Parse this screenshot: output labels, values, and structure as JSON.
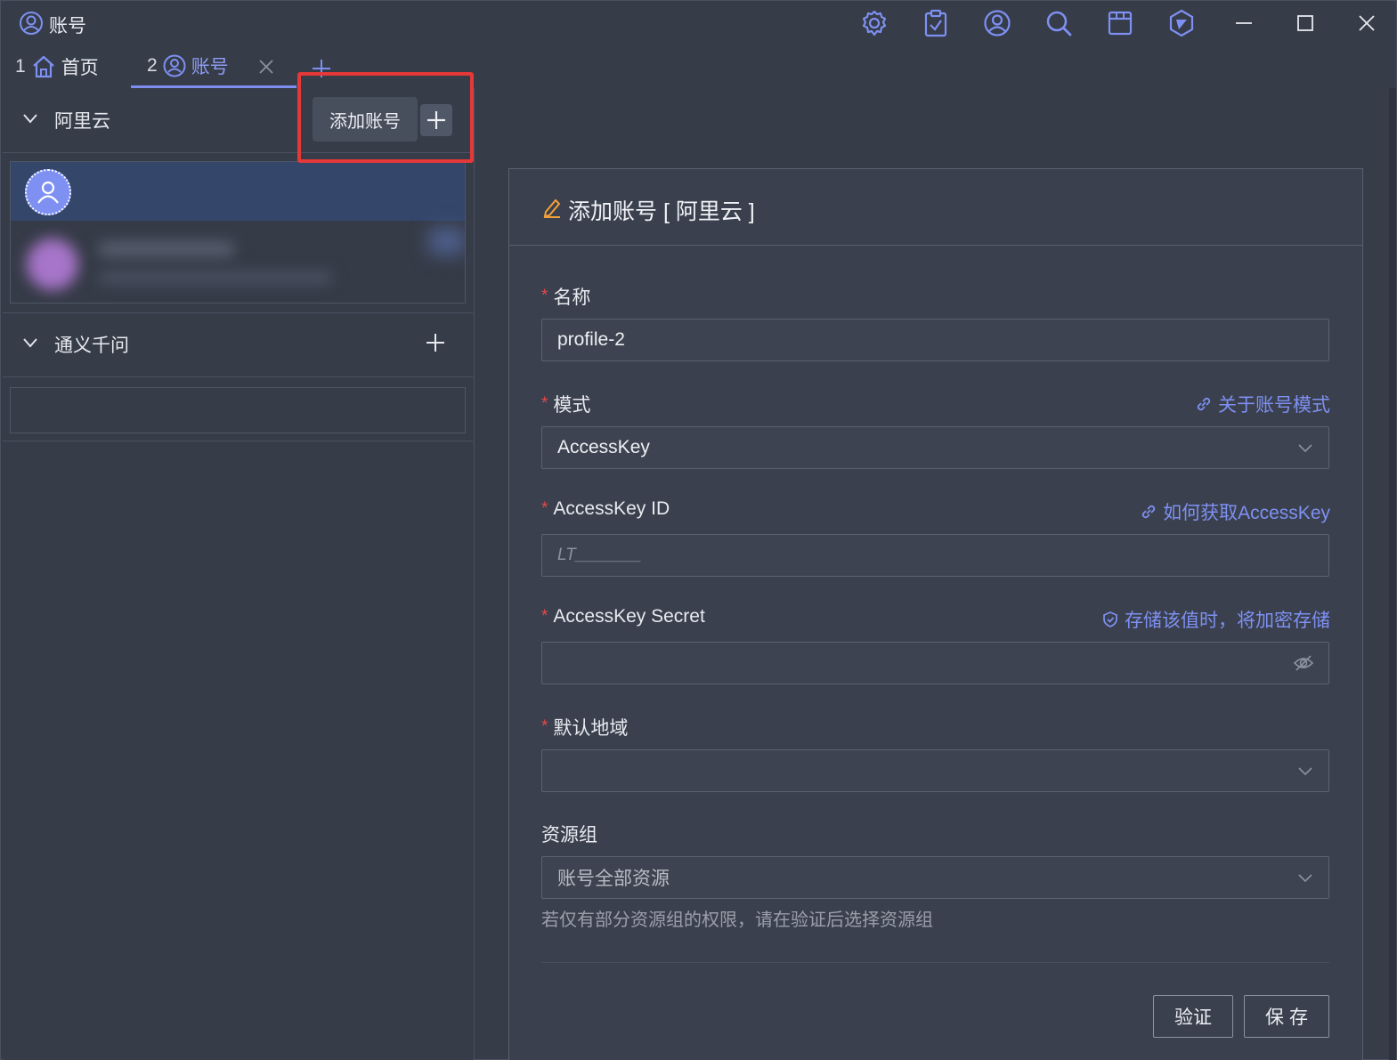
{
  "window": {
    "title": "账号",
    "toolbar_icons": [
      "gear-icon",
      "clipboard-check-icon",
      "user-circle-icon",
      "search-icon",
      "window-icon",
      "logo-icon"
    ],
    "controls": [
      "minimize-icon",
      "maximize-icon",
      "close-icon"
    ]
  },
  "tabs": [
    {
      "num": "1",
      "label": "首页",
      "icon": "home-icon"
    },
    {
      "num": "2",
      "label": "账号",
      "icon": "user-circle-icon",
      "active": true
    }
  ],
  "sidebar": {
    "groups": [
      {
        "name": "阿里云"
      },
      {
        "name": "通义千问"
      }
    ],
    "popup": {
      "label": "添加账号"
    }
  },
  "form": {
    "title": "添加账号 [ 阿里云 ]",
    "fields": {
      "name": {
        "label": "名称",
        "required": true,
        "value": "profile-2"
      },
      "mode": {
        "label": "模式",
        "required": true,
        "value": "AccessKey",
        "link": "关于账号模式"
      },
      "ak_id": {
        "label": "AccessKey ID",
        "required": true,
        "placeholder": "LT_______",
        "link": "如何获取AccessKey"
      },
      "ak_secret": {
        "label": "AccessKey Secret",
        "required": true,
        "value": "",
        "note": "存储该值时，将加密存储"
      },
      "region": {
        "label": "默认地域",
        "required": true,
        "value": ""
      },
      "resource_group": {
        "label": "资源组",
        "required": false,
        "value": "账号全部资源",
        "hint": "若仅有部分资源组的权限，请在验证后选择资源组"
      }
    },
    "buttons": {
      "verify": "验证",
      "save": "保存"
    }
  },
  "colors": {
    "accent": "#7e90f2",
    "background": "#363c48",
    "required": "#e5484d",
    "highlight": "#e53838",
    "edit_icon": "#f2a23a"
  }
}
